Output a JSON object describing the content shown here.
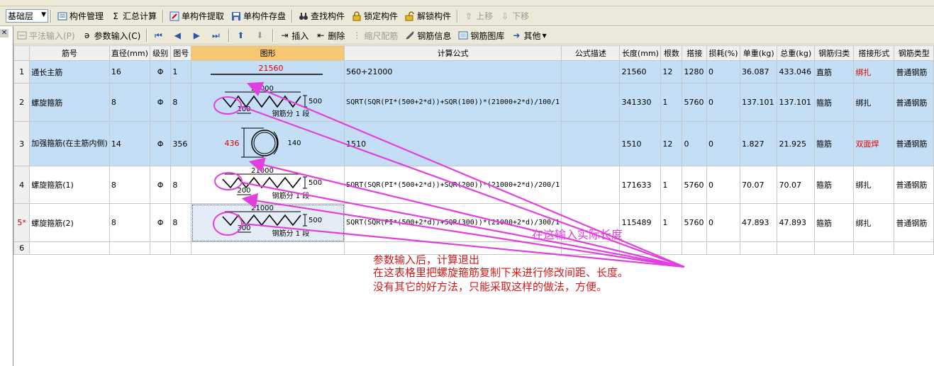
{
  "toolbar1": {
    "floor": "基础层",
    "buttons": [
      {
        "label": "构件管理",
        "icon": "component-manager-icon",
        "disabled": false
      },
      {
        "label": "汇总计算",
        "icon": "sigma-icon",
        "glyph": "Σ",
        "disabled": false
      },
      {
        "label": "单构件提取",
        "icon": "extract-icon",
        "disabled": false
      },
      {
        "label": "单构件存盘",
        "icon": "save-component-icon",
        "disabled": false
      },
      {
        "label": "查找构件",
        "icon": "binoculars-icon",
        "disabled": false
      },
      {
        "label": "锁定构件",
        "icon": "lock-icon",
        "disabled": false
      },
      {
        "label": "解锁构件",
        "icon": "unlock-icon",
        "disabled": false
      },
      {
        "label": "上移",
        "icon": "move-up-icon",
        "disabled": true
      },
      {
        "label": "下移",
        "icon": "move-down-icon",
        "disabled": true
      }
    ]
  },
  "toolbar2": {
    "buttons": [
      {
        "label": "平法输入(P)",
        "disabled": true
      },
      {
        "label": "参数输入(C)",
        "disabled": false
      },
      {
        "label": "插入",
        "disabled": false
      },
      {
        "label": "删除",
        "disabled": false
      },
      {
        "label": "缩尺配筋",
        "disabled": true
      },
      {
        "label": "钢筋信息",
        "disabled": false
      },
      {
        "label": "钢筋图库",
        "disabled": false
      },
      {
        "label": "其他",
        "disabled": false
      }
    ]
  },
  "table": {
    "headers": [
      "",
      "筋号",
      "直径(mm)",
      "级别",
      "图号",
      "图形",
      "计算公式",
      "公式描述",
      "长度(mm)",
      "根数",
      "搭接",
      "损耗(%)",
      "单重(kg)",
      "总重(kg)",
      "钢筋归类",
      "搭接形式",
      "钢筋类型"
    ],
    "rows": [
      {
        "no": "1",
        "name": "通长主筋",
        "dia": "16",
        "grade": "Φ",
        "fig": "1",
        "shape_text": "21560",
        "formula": "560+21000",
        "desc": "",
        "length": "21560",
        "count": "12",
        "lap": "1280",
        "loss": "0",
        "unit_wt": "36.087",
        "total_wt": "433.046",
        "category": "直筋",
        "lap_form": "绑扎",
        "type": "普通钢筋"
      },
      {
        "no": "2",
        "name": "螺旋箍筋",
        "dia": "8",
        "grade": "Φ",
        "fig": "8",
        "shape_len": "21000",
        "shape_h": "500",
        "shape_pitch": "100",
        "shape_seg": "钢筋分 1 段",
        "formula": "SQRT(SQR(PI*(500+2*d))+SQR(100))*(21000+2*d)/100/1",
        "desc": "",
        "length": "341330",
        "count": "1",
        "lap": "5760",
        "loss": "0",
        "unit_wt": "137.101",
        "total_wt": "137.101",
        "category": "箍筋",
        "lap_form": "绑扎",
        "type": "普通钢筋"
      },
      {
        "no": "3",
        "name": "加强箍筋(在主筋内侧)",
        "dia": "14",
        "grade": "Φ",
        "fig": "356",
        "shape_d": "436",
        "shape_r": "140",
        "formula": "1510",
        "desc": "",
        "length": "1510",
        "count": "12",
        "lap": "0",
        "loss": "0",
        "unit_wt": "1.827",
        "total_wt": "21.925",
        "category": "箍筋",
        "lap_form": "双面焊",
        "type": "普通钢筋"
      },
      {
        "no": "4",
        "name": "螺旋箍筋(1)",
        "dia": "8",
        "grade": "Φ",
        "fig": "8",
        "shape_len": "21000",
        "shape_h": "500",
        "shape_pitch": "200",
        "shape_seg": "钢筋分 1 段",
        "formula": "SQRT(SQR(PI*(500+2*d))+SQR(200))*(21000+2*d)/200/1",
        "desc": "",
        "length": "171633",
        "count": "1",
        "lap": "5760",
        "loss": "0",
        "unit_wt": "70.07",
        "total_wt": "70.07",
        "category": "箍筋",
        "lap_form": "绑扎",
        "type": "普通钢筋"
      },
      {
        "no": "5*",
        "name": "螺旋箍筋(2)",
        "dia": "8",
        "grade": "Φ",
        "fig": "8",
        "shape_len": "21000",
        "shape_h": "500",
        "shape_pitch": "300",
        "shape_seg": "钢筋分 1 段",
        "formula": "SQRT(SQR(PI*(500+2*d))+SQR(300))*(21000+2*d)/300/1",
        "desc": "",
        "length": "115489",
        "count": "1",
        "lap": "5760",
        "loss": "0",
        "unit_wt": "47.893",
        "total_wt": "47.893",
        "category": "箍筋",
        "lap_form": "绑扎",
        "type": "普通钢筋"
      },
      {
        "no": "6"
      }
    ]
  },
  "annotations": {
    "input_length_note": "在这输入实际长度",
    "note_line1": "参数输入后，计算退出",
    "note_line2": "在这表格里把螺旋箍筋复制下来进行修改间距、长度。",
    "note_line3": "没有其它的好方法，只能采取这样的做法，方便。"
  },
  "colors": {
    "annotation_magenta": "#e23fe0",
    "annotation_red": "#d11a1a",
    "selected_row": "#c4def5",
    "header_highlight": "#f7c873"
  }
}
